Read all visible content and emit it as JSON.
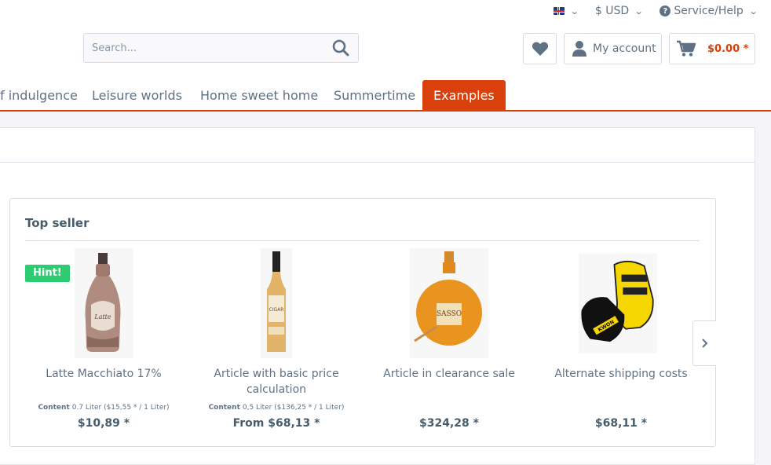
{
  "topbar": {
    "language_icon": "uk-flag-icon",
    "currency": "$ USD",
    "service": "Service/Help"
  },
  "search": {
    "placeholder": "Search..."
  },
  "account": {
    "label": "My account"
  },
  "cart": {
    "amount": "$0.00 *"
  },
  "nav": {
    "items": [
      {
        "label": "f indulgence"
      },
      {
        "label": "Leisure worlds"
      },
      {
        "label": "Home sweet home"
      },
      {
        "label": "Summertime"
      },
      {
        "label": "Examples",
        "active": true
      }
    ]
  },
  "slider": {
    "title": "Top seller",
    "badge": "Hint!",
    "products": [
      {
        "name": "Latte Macchiato 17%",
        "content_label": "Content",
        "content_value": "0.7 Liter ($15,55 * / 1 Liter)",
        "price": "$10,89 *"
      },
      {
        "name": "Article with basic price calculation",
        "content_label": "Content",
        "content_value": "0,5 Liter ($136,25 * / 1 Liter)",
        "price": "From $68,13 *"
      },
      {
        "name": "Article in clearance sale",
        "content_label": "",
        "content_value": "",
        "price": "$324,28 *"
      },
      {
        "name": "Alternate shipping costs",
        "content_label": "",
        "content_value": "",
        "price": "$68,11 *"
      }
    ]
  },
  "colors": {
    "accent": "#d9400b",
    "badge": "#2ecc71",
    "text": "#5f7285"
  }
}
